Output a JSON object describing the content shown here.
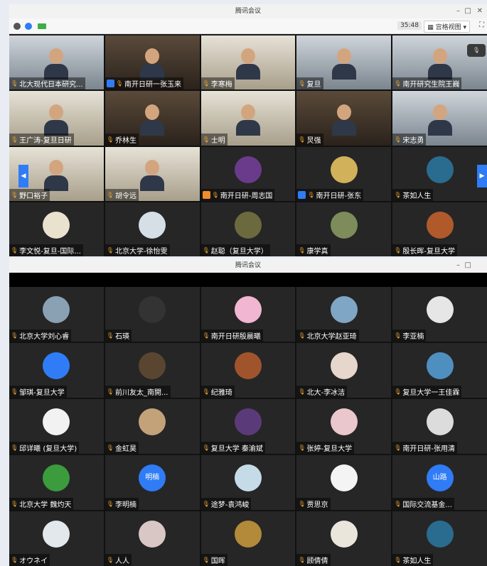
{
  "window1": {
    "title": "腾讯会议",
    "timer": "35:48",
    "view_button": "宫格视图",
    "tiles": [
      {
        "name": "北大现代日本研究...",
        "kind": "video",
        "style": "v2"
      },
      {
        "name": "南开日研一张玉来",
        "kind": "video",
        "style": "v3",
        "badge": "#2f7cf6"
      },
      {
        "name": "李寒梅",
        "kind": "video",
        "style": "v4"
      },
      {
        "name": "复旦",
        "kind": "video",
        "style": "v2"
      },
      {
        "name": "南开研究生院王巍",
        "kind": "video",
        "style": "v2"
      },
      {
        "name": "王广涛-复旦日研",
        "kind": "video",
        "style": "v4"
      },
      {
        "name": "乔林生",
        "kind": "video",
        "style": "v3"
      },
      {
        "name": "士明",
        "kind": "video",
        "style": "v4"
      },
      {
        "name": "炅强",
        "kind": "video",
        "style": "v3"
      },
      {
        "name": "宋志勇",
        "kind": "video",
        "style": "v2"
      },
      {
        "name": "野口裕子",
        "kind": "video",
        "style": "v4"
      },
      {
        "name": "胡令远",
        "kind": "video",
        "style": "v4"
      },
      {
        "name": "南开日研-周志国",
        "kind": "avatar",
        "color": "#6a3b8a",
        "badge": "#f08c2e"
      },
      {
        "name": "南开日研-张东",
        "kind": "avatar",
        "color": "#d1b15a",
        "badge": "#2f7cf6"
      },
      {
        "name": "茶如人生",
        "kind": "avatar",
        "color": "#2a6c8f"
      },
      {
        "name": "李文悦-复旦-国际...",
        "kind": "avatar",
        "color": "#e9e2cf"
      },
      {
        "name": "北京大学-徐怡雯",
        "kind": "avatar",
        "color": "#d6dfe6"
      },
      {
        "name": "赵聪（复旦大学）",
        "kind": "avatar",
        "color": "#6b6a3f"
      },
      {
        "name": "康学真",
        "kind": "avatar",
        "color": "#7e8b5a"
      },
      {
        "name": "殷长晖-复旦大学",
        "kind": "avatar",
        "color": "#b05a2c"
      }
    ]
  },
  "window2": {
    "title": "腾讯会议",
    "tiles": [
      {
        "name": "北京大学刘心睿",
        "color": "#8aa0b3"
      },
      {
        "name": "石瑛",
        "color": "#333333"
      },
      {
        "name": "南开日研殷晨曦",
        "color": "#f1b6d1"
      },
      {
        "name": "北京大学赵亚琦",
        "color": "#7fa6c4"
      },
      {
        "name": "李亚楠",
        "color": "#e6e6e6"
      },
      {
        "name": "邹琪-复旦大学",
        "color": "#2f7cf6"
      },
      {
        "name": "前川友太_南開...",
        "color": "#5a4630"
      },
      {
        "name": "纪雅琦",
        "color": "#a0542c"
      },
      {
        "name": "北大-李冰洁",
        "color": "#e7d6cc"
      },
      {
        "name": "复旦大学一王佳霖",
        "color": "#4f8fc0"
      },
      {
        "name": "邱详曦 (复旦大学)",
        "color": "#f2f2f2"
      },
      {
        "name": "金虹昊",
        "color": "#c3a27a"
      },
      {
        "name": "复旦大学 秦渝斌",
        "color": "#5b3a7a"
      },
      {
        "name": "张婷-复旦大学",
        "color": "#e9c7cc"
      },
      {
        "name": "南开日研-张用清",
        "color": "#dcdcdc"
      },
      {
        "name": "北京大学 魏灼天",
        "color": "#3c9b3c"
      },
      {
        "name": "李明楠",
        "color": "#2f7cf6",
        "text": "明楠"
      },
      {
        "name": "途梦-袁鸿峻",
        "color": "#c6dbe8"
      },
      {
        "name": "贾思京",
        "color": "#f4f4f4"
      },
      {
        "name": "国际交流基金...",
        "color": "#2f7cf6",
        "text": "山路"
      },
      {
        "name": "オウネイ",
        "color": "#e2e8ec"
      },
      {
        "name": "人人",
        "color": "#d8c7c4"
      },
      {
        "name": "国晖",
        "color": "#b38a3a"
      },
      {
        "name": "顾倩倩",
        "color": "#eae6dc"
      },
      {
        "name": "茶如人生",
        "color": "#2a6c8f"
      }
    ]
  }
}
